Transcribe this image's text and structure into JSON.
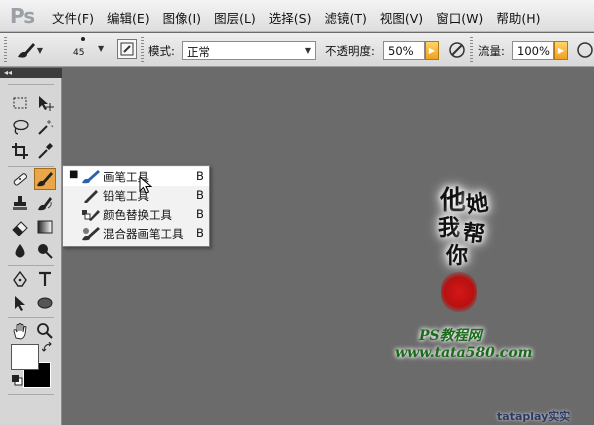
{
  "app": {
    "logo": "Ps"
  },
  "menubar": {
    "items": [
      "文件(F)",
      "编辑(E)",
      "图像(I)",
      "图层(L)",
      "选择(S)",
      "滤镜(T)",
      "视图(V)",
      "窗口(W)",
      "帮助(H)"
    ]
  },
  "options": {
    "brush_size": "45",
    "mode_label": "模式:",
    "mode_value": "正常",
    "opacity_label": "不透明度:",
    "opacity_value": "50%",
    "flow_label": "流量:",
    "flow_value": "100%"
  },
  "flyout": {
    "items": [
      {
        "name": "画笔工具",
        "key": "B",
        "selected": true
      },
      {
        "name": "铅笔工具",
        "key": "B",
        "selected": false
      },
      {
        "name": "颜色替换工具",
        "key": "B",
        "selected": false
      },
      {
        "name": "混合器画笔工具",
        "key": "B",
        "selected": false
      }
    ]
  },
  "watermark": {
    "chars": [
      "他",
      "她",
      "我",
      "帮",
      "你"
    ],
    "title": "PS教程网",
    "url": "www.tata580.com",
    "credit": "tataplay实实"
  },
  "colors": {
    "canvas": "#6b6b6b",
    "active_tool": "#e9a74a",
    "accent_orange": "#f0a21e",
    "seal_red": "#d41818",
    "watermark_green": "#1c6b1c"
  },
  "icons": {
    "brush": "brush-icon",
    "marquee": "rect-marquee-icon",
    "move": "move-icon",
    "lasso": "lasso-icon",
    "magic_wand": "magic-wand-icon",
    "crop": "crop-icon",
    "eyedropper": "eyedropper-icon",
    "hand": "hand-icon",
    "zoom": "zoom-icon"
  }
}
